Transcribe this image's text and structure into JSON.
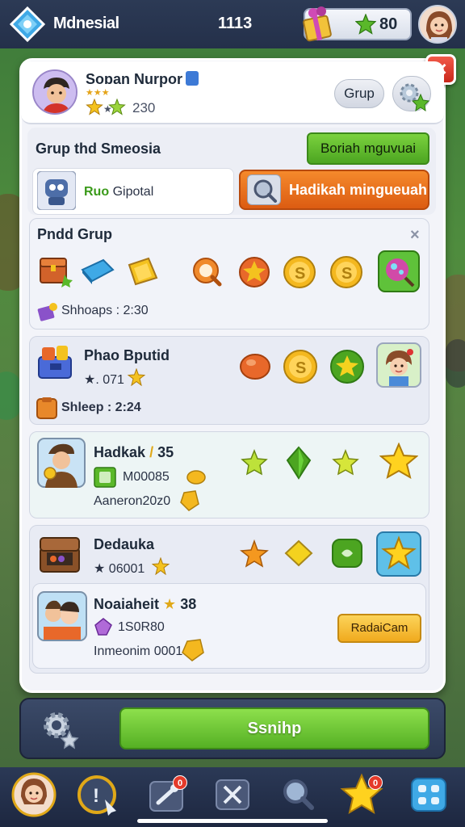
{
  "topbar": {
    "title": "Mdnesial",
    "counter": "1113",
    "gems": "80",
    "logo_icon": "diamond-logo-icon",
    "gift_icon": "gift-box-icon",
    "currency_icon": "green-star-icon"
  },
  "profile": {
    "name": "Soɒan Nurpor",
    "stars_label": "★★★",
    "score": "230",
    "group_button": "Grup"
  },
  "group": {
    "title": "Grup thd Smeosia",
    "green_button": "Boriah mguvuai",
    "search_card_accent": "Ruo",
    "search_card_label": "Gipotal",
    "orange_button": "Hadikah mingueuah"
  },
  "cards": {
    "c1": {
      "title": "Pndd Grup",
      "footer": "Shhoaps : 2:30"
    },
    "c2": {
      "title": "Phao Bputid",
      "sub": "★. 071",
      "footer": "Shleep : 2:24"
    },
    "c3": {
      "title": "Hadkak",
      "title_suffix": "35",
      "sub": "M00085",
      "footer": "Aaneron20z0"
    },
    "c4": {
      "title": "Dedauka",
      "sub": "★ 06001"
    },
    "c5": {
      "title": "Noaiaheit",
      "title_suffix": "38",
      "sub": "1S0R80",
      "footer": "Inmeonim 0001",
      "button": "RadaiCam"
    }
  },
  "bottom": {
    "main_button": "Ssnihp"
  },
  "navbar": {
    "badge_1": "0",
    "badge_2": "0"
  },
  "colors": {
    "accent_green": "#55b024",
    "accent_orange": "#dc5c12",
    "panel_bg": "#f3f4f9",
    "nav_bg": "#1d2740",
    "close_red": "#c9271b"
  }
}
